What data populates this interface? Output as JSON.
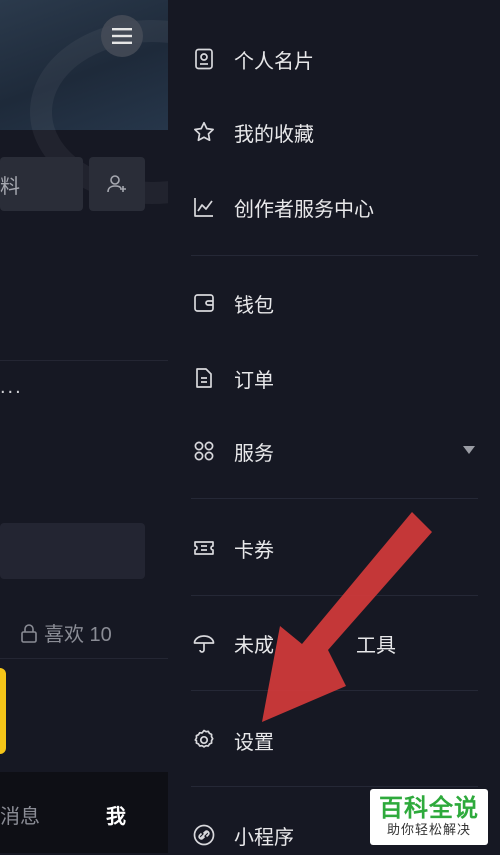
{
  "left_panel": {
    "edit_button_partial": "料",
    "ellipsis_text": "...",
    "likes_label": "喜欢 10",
    "tabs": [
      {
        "label": "消息"
      },
      {
        "label": "我"
      }
    ]
  },
  "drawer": {
    "groups": [
      [
        {
          "label": "个人名片",
          "icon": "id-card-icon"
        },
        {
          "label": "我的收藏",
          "icon": "star-icon"
        },
        {
          "label": "创作者服务中心",
          "icon": "chart-line-icon"
        }
      ],
      [
        {
          "label": "钱包",
          "icon": "wallet-icon"
        },
        {
          "label": "订单",
          "icon": "document-icon"
        },
        {
          "label": "服务",
          "icon": "grid-icon",
          "expandable": true
        }
      ],
      [
        {
          "label": "卡券",
          "icon": "ticket-icon"
        }
      ],
      [
        {
          "label": "未成年人保护工具",
          "visible_text": "未成",
          "visible_text_tail": "工具",
          "icon": "umbrella-icon"
        }
      ],
      [
        {
          "label": "设置",
          "icon": "gear-icon"
        }
      ],
      [
        {
          "label": "小程序",
          "icon": "link-icon"
        }
      ]
    ]
  },
  "annotation": {
    "arrow_color": "#d23a3a"
  },
  "watermark": {
    "title": "百科全说",
    "subtitle": "助你轻松解决"
  },
  "colors": {
    "background": "#161823",
    "text": "#e8e8ea",
    "watermark_green": "#2eaa3c"
  }
}
